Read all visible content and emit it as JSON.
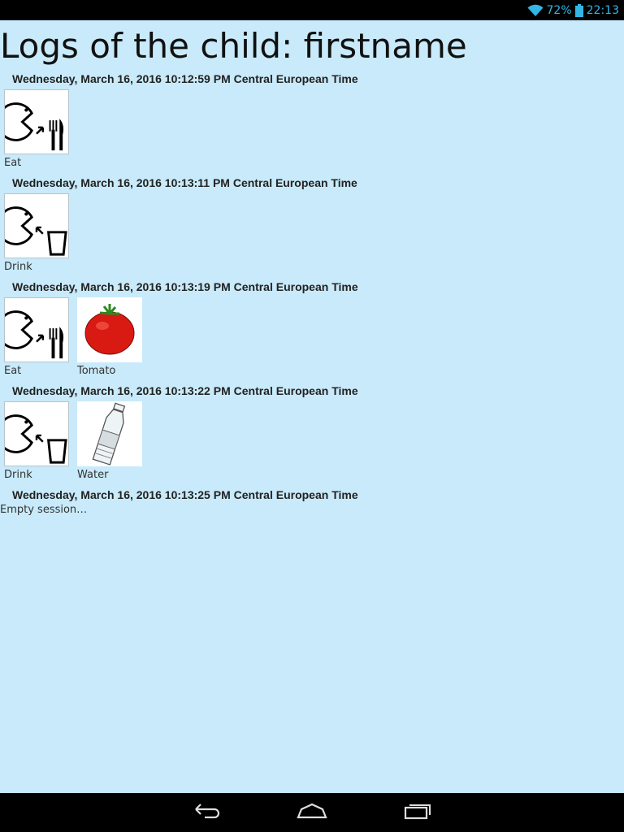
{
  "status_bar": {
    "battery_percent": "72%",
    "time": "22:13",
    "icons": [
      "wifi-icon",
      "battery-icon"
    ],
    "accent_color": "#33b5e5"
  },
  "page": {
    "title": "Logs of the child: firstname",
    "background_color": "#c8eafa"
  },
  "sessions": [
    {
      "timestamp": "Wednesday, March 16, 2016 10:12:59 PM Central European Time",
      "items": [
        {
          "label": "Eat",
          "icon": "eat-icon"
        }
      ]
    },
    {
      "timestamp": "Wednesday, March 16, 2016 10:13:11 PM Central European Time",
      "items": [
        {
          "label": "Drink",
          "icon": "drink-icon"
        }
      ]
    },
    {
      "timestamp": "Wednesday, March 16, 2016 10:13:19 PM Central European Time",
      "items": [
        {
          "label": "Eat",
          "icon": "eat-icon"
        },
        {
          "label": "Tomato",
          "icon": "tomato-icon"
        }
      ]
    },
    {
      "timestamp": "Wednesday, March 16, 2016 10:13:22 PM Central European Time",
      "items": [
        {
          "label": "Drink",
          "icon": "drink-icon"
        },
        {
          "label": "Water",
          "icon": "water-bottle-icon"
        }
      ]
    },
    {
      "timestamp": "Wednesday, March 16, 2016 10:13:25 PM Central European Time",
      "items": [],
      "empty_text": "Empty session…"
    }
  ],
  "nav_bar": {
    "buttons": [
      "back-icon",
      "home-icon",
      "recent-apps-icon"
    ]
  }
}
